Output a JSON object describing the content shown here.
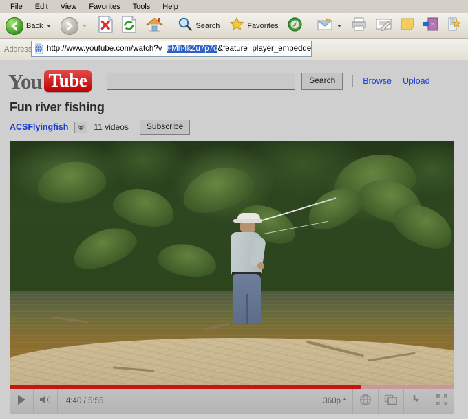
{
  "browser": {
    "menu": [
      "File",
      "Edit",
      "View",
      "Favorites",
      "Tools",
      "Help"
    ],
    "nav": {
      "back_label": "Back",
      "back_icon": "back-arrow-icon",
      "forward_icon": "forward-arrow-icon",
      "stop_icon": "stop-icon",
      "refresh_icon": "refresh-icon",
      "home_icon": "home-icon",
      "search_label": "Search",
      "search_icon": "magnifier-icon",
      "favorites_label": "Favorites",
      "favorites_icon": "star-icon",
      "media_icon": "media-icon",
      "mail_icon": "mail-icon",
      "print_icon": "printer-icon",
      "edit_icon": "edit-page-icon",
      "notes_icon": "note-icon",
      "onenote_icon": "onenote-icon",
      "research_icon": "research-icon",
      "encarta_icon": "encarta-icon",
      "messenger_icon": "messenger-icon"
    },
    "address": {
      "label": "Address",
      "favicon": "page-globe-icon",
      "url_prefix": "http://www.youtube.com/watch?v=",
      "url_selected": "FMh4kZu7p7o",
      "url_suffix": "&feature=player_embedded",
      "selection_color": "#2b5fc9"
    }
  },
  "youtube": {
    "logo": {
      "you": "You",
      "tube": "Tube",
      "tube_bg": "#c00000"
    },
    "search": {
      "value": "",
      "placeholder": "",
      "button_label": "Search"
    },
    "links": [
      "Browse",
      "Upload"
    ],
    "video": {
      "title": "Fun river fishing",
      "uploader": "ACSFlyingfish",
      "uploader_color": "#1b3fcf",
      "expand_icon": "chevron-down-icon",
      "video_count": "11 videos",
      "subscribe_label": "Subscribe"
    },
    "player": {
      "play_icon": "play-icon",
      "volume_icon": "volume-icon",
      "time_current": "4:40",
      "time_separator": "/",
      "time_total": "5:55",
      "time_display": "4:40 / 5:55",
      "progress_percent": 78.9,
      "progress_color": "#c81414",
      "quality_label": "360p",
      "quality_caret_icon": "caret-up-icon",
      "cc_icon": "captions-globe-icon",
      "popout_icon": "popout-icon",
      "share_icon": "share-arrow-icon",
      "fullscreen_icon": "fullscreen-icon"
    },
    "scene": {
      "description": "Man fly fishing in a tropical river with dense green jungle on the far bank and a sandy beach in the foreground",
      "jungle_color": "#2a4019",
      "water_color": "#8a6f31",
      "sand_color": "#c7b58e"
    }
  }
}
